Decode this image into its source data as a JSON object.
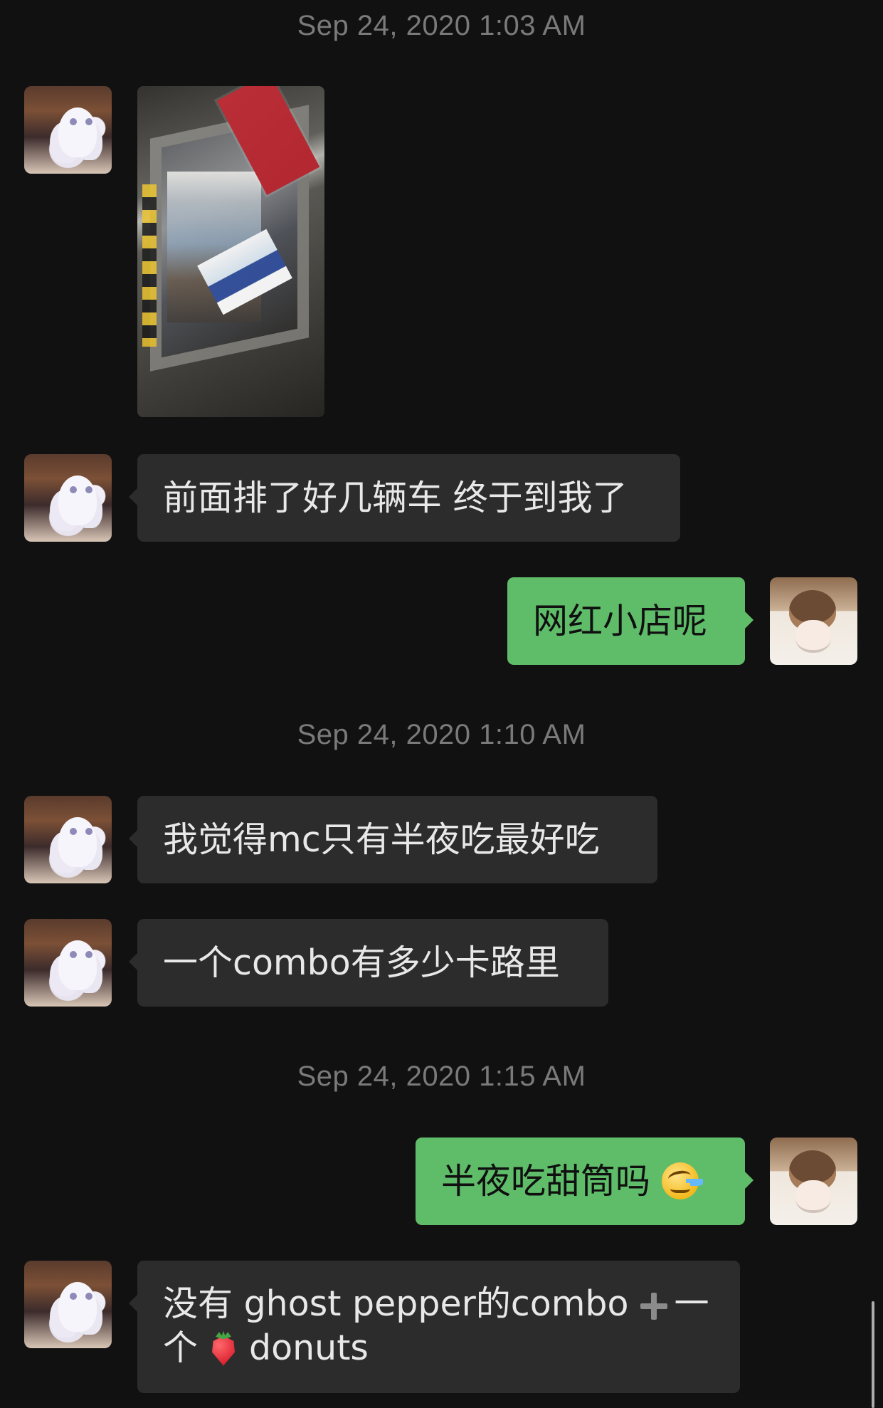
{
  "chat": {
    "timestamps": [
      "Sep 24, 2020 1:03 AM",
      "Sep 24, 2020 1:10 AM",
      "Sep 24, 2020 1:15 AM"
    ],
    "messages": {
      "m1": "前面排了好几辆车 终于到我了",
      "m2": "网红小店呢",
      "m3": "我觉得mc只有半夜吃最好吃",
      "m4": "一个combo有多少卡路里",
      "m5_text": "半夜吃甜筒吗",
      "m6_line1_before_icon": "没有 ghost pepper的combo",
      "m6_line1_after_icon": "一",
      "m6_line2_prefix": "个",
      "m6_line2_suffix": "donuts"
    },
    "icons": {
      "other_avatar": "anime-avatar",
      "self_avatar": "anime-avatar",
      "emoji_1": "laughing-crying-emoji-icon",
      "emoji_2": "plus-icon",
      "emoji_3": "strawberry-icon"
    }
  }
}
